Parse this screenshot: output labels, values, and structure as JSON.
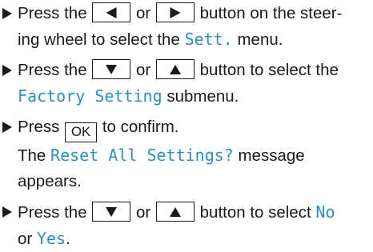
{
  "steps": [
    {
      "line1_a": "Press the",
      "key_left": "left-arrow-key",
      "line1_or": "or",
      "key_right": "right-arrow-key",
      "line1_b": "button on the steer-",
      "line2_a": "ing wheel to select the",
      "menu": "Sett.",
      "line2_b": "menu."
    },
    {
      "line1_a": "Press the",
      "key_down": "down-arrow-key",
      "line1_or": "or",
      "key_up": "up-arrow-key",
      "line1_b": "button to select the",
      "submenu": "Factory Setting",
      "line2_b": "submenu."
    },
    {
      "line1_a": "Press",
      "key_ok": "OK",
      "line1_b": "to confirm.",
      "line2_a": "The",
      "message": "Reset All Settings?",
      "line2_b": "message",
      "line3": "appears."
    },
    {
      "line1_a": "Press the",
      "key_down": "down-arrow-key",
      "line1_or": "or",
      "key_up": "up-arrow-key",
      "line1_b": "button to select",
      "option_no": "No",
      "line2_a": "or",
      "option_yes": "Yes",
      "line2_end": "."
    }
  ]
}
